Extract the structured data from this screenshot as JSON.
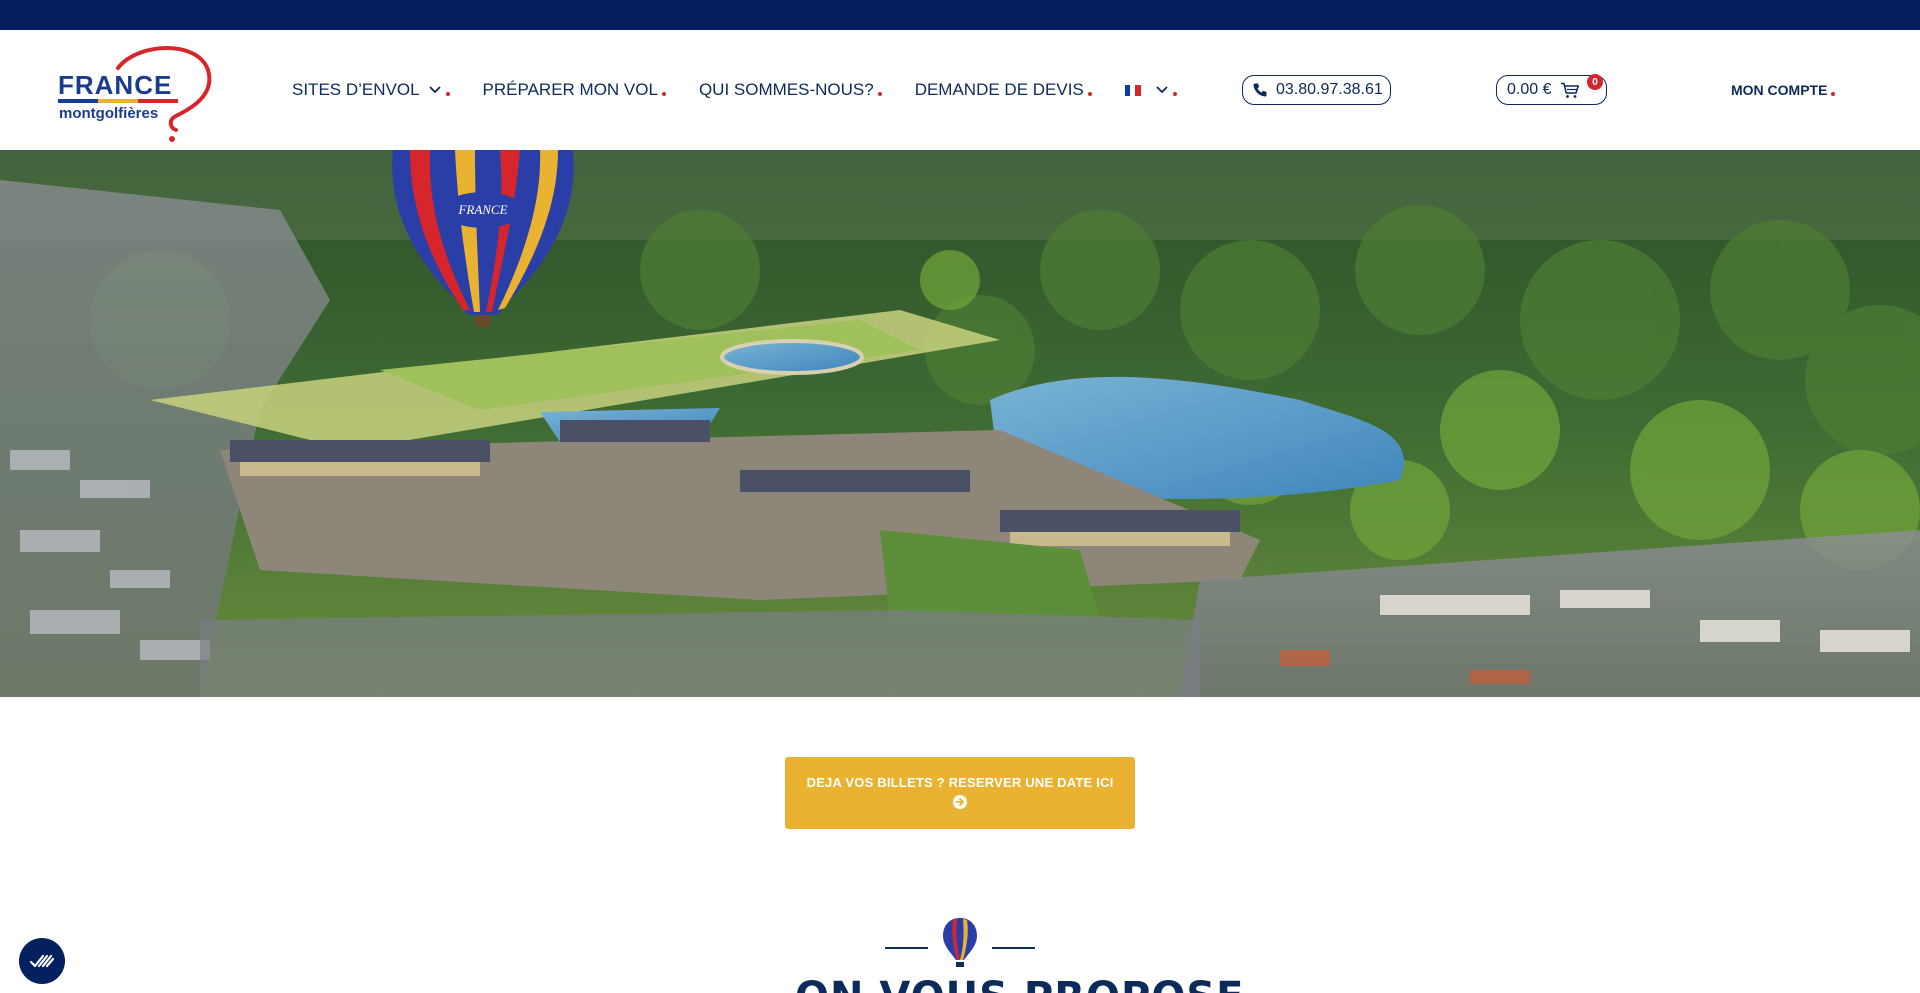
{
  "brand": {
    "logo_word": "FRANCE",
    "logo_sub": "montgolfières",
    "colors": {
      "navy": "#05205e",
      "red": "#d6262c",
      "yellow": "#eab231",
      "blue": "#1a3c8f"
    }
  },
  "nav": {
    "items": [
      {
        "label": "SITES D’ENVOL",
        "has_dropdown": true
      },
      {
        "label": "PRÉPARER MON VOL",
        "has_dropdown": false
      },
      {
        "label": "QUI SOMMES-NOUS?",
        "has_dropdown": false
      },
      {
        "label": "DEMANDE DE DEVIS",
        "has_dropdown": false
      }
    ],
    "language": {
      "icon": "french-flag-icon",
      "has_dropdown": true
    }
  },
  "header": {
    "phone": "03.80.97.38.61",
    "phone_icon": "phone-icon",
    "cart_total": "0.00 €",
    "cart_icon": "cart-icon",
    "cart_count": "0",
    "account_label": "MON COMPTE"
  },
  "hero": {
    "image": "aerial-view-chateau-fontainebleau-with-hot-air-balloon"
  },
  "cta": {
    "label": "DEJA VOS BILLETS ? RESERVER UNE DATE ICI",
    "icon": "arrow-circle-right-icon"
  },
  "section": {
    "title": "ON VOUS PROPOSE",
    "icon": "balloon-icon"
  },
  "accessibility": {
    "icon": "accessibility-icon"
  }
}
